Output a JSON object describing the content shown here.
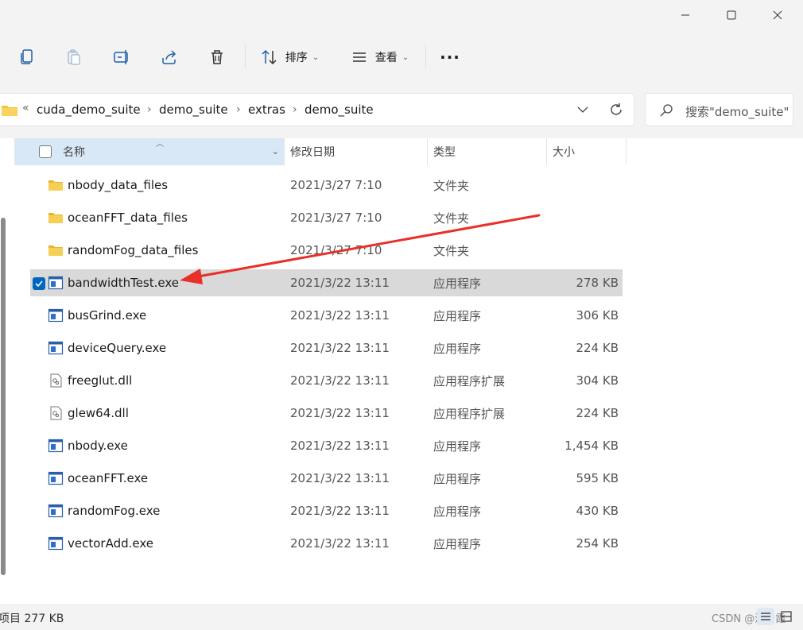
{
  "window": {
    "minimize_icon": "minimize-icon",
    "maximize_icon": "maximize-icon",
    "close_icon": "close-icon"
  },
  "toolbar": {
    "sort_label": "排序",
    "view_label": "查看",
    "more_label": "···"
  },
  "address": {
    "overflow_label": "«",
    "crumbs": [
      "cuda_demo_suite",
      "demo_suite",
      "extras",
      "demo_suite"
    ],
    "separator": "›"
  },
  "search": {
    "placeholder": "搜索\"demo_suite\""
  },
  "columns": {
    "name": "名称",
    "date": "修改日期",
    "type": "类型",
    "size": "大小"
  },
  "files": [
    {
      "name": "nbody_data_files",
      "date": "2021/3/27 7:10",
      "type": "文件夹",
      "size": "",
      "icon": "folder-icon"
    },
    {
      "name": "oceanFFT_data_files",
      "date": "2021/3/27 7:10",
      "type": "文件夹",
      "size": "",
      "icon": "folder-icon"
    },
    {
      "name": "randomFog_data_files",
      "date": "2021/3/27 7:10",
      "type": "文件夹",
      "size": "",
      "icon": "folder-icon"
    },
    {
      "name": "bandwidthTest.exe",
      "date": "2021/3/22 13:11",
      "type": "应用程序",
      "size": "278 KB",
      "icon": "exe-icon",
      "selected": true
    },
    {
      "name": "busGrind.exe",
      "date": "2021/3/22 13:11",
      "type": "应用程序",
      "size": "306 KB",
      "icon": "exe-icon"
    },
    {
      "name": "deviceQuery.exe",
      "date": "2021/3/22 13:11",
      "type": "应用程序",
      "size": "224 KB",
      "icon": "exe-icon"
    },
    {
      "name": "freeglut.dll",
      "date": "2021/3/22 13:11",
      "type": "应用程序扩展",
      "size": "304 KB",
      "icon": "dll-icon"
    },
    {
      "name": "glew64.dll",
      "date": "2021/3/22 13:11",
      "type": "应用程序扩展",
      "size": "224 KB",
      "icon": "dll-icon"
    },
    {
      "name": "nbody.exe",
      "date": "2021/3/22 13:11",
      "type": "应用程序",
      "size": "1,454 KB",
      "icon": "exe-icon"
    },
    {
      "name": "oceanFFT.exe",
      "date": "2021/3/22 13:11",
      "type": "应用程序",
      "size": "595 KB",
      "icon": "exe-icon"
    },
    {
      "name": "randomFog.exe",
      "date": "2021/3/22 13:11",
      "type": "应用程序",
      "size": "430 KB",
      "icon": "exe-icon"
    },
    {
      "name": "vectorAdd.exe",
      "date": "2021/3/22 13:11",
      "type": "应用程序",
      "size": "254 KB",
      "icon": "exe-icon"
    }
  ],
  "status": {
    "selection": "项目 277 KB",
    "watermark": "CSDN @濯云霞"
  },
  "colors": {
    "accent": "#0067c0",
    "selected_row": "#d9d9d9",
    "header_sorted": "#d8e8f7",
    "annotation_arrow": "#e8302a",
    "folder": "#f4c440"
  }
}
